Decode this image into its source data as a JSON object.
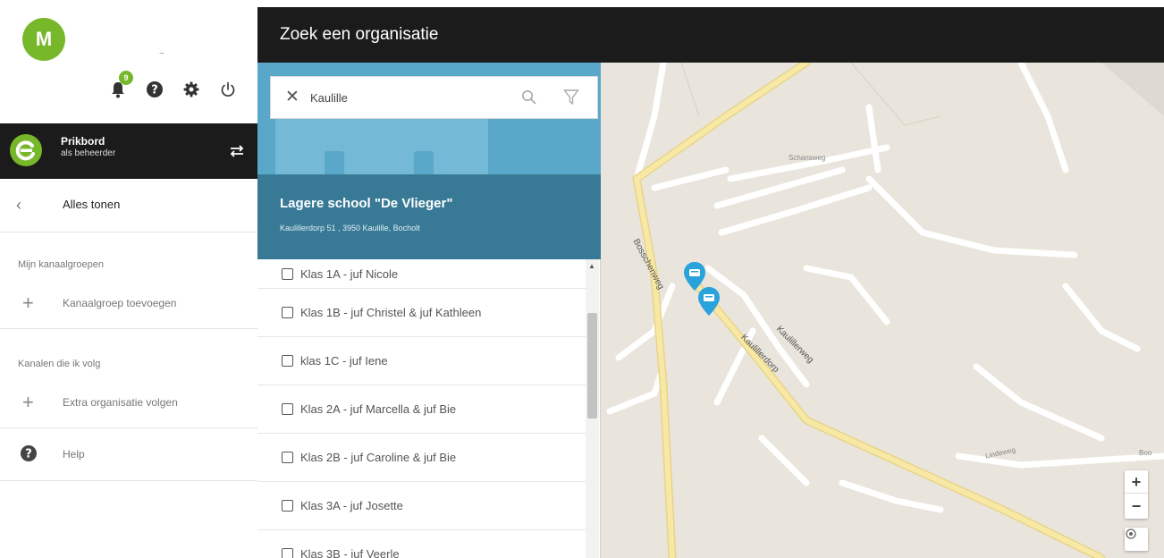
{
  "user": {
    "avatar_initial": "M",
    "subtitle": "~"
  },
  "notifications": {
    "count": "9"
  },
  "channel": {
    "name": "Prikbord",
    "role": "als beheerder"
  },
  "sidebar": {
    "show_all": "Alles tonen",
    "section_groups": "Mijn kanaalgroepen",
    "add_group": "Kanaalgroep toevoegen",
    "section_follow": "Kanalen die ik volg",
    "follow_org": "Extra organisatie volgen",
    "help": "Help"
  },
  "header": {
    "title": "Zoek een organisatie"
  },
  "search": {
    "value": "Kaulille"
  },
  "organization": {
    "name": "Lagere school \"De Vlieger\"",
    "address": "Kaulillerdorp 51 , 3950 Kaulille, Bocholt"
  },
  "classes": [
    "Klas 1A - juf Nicole",
    "Klas 1B - juf Christel & juf Kathleen",
    "klas 1C - juf Iene",
    "Klas 2A - juf Marcella & juf Bie",
    "Klas 2B - juf Caroline & juf Bie",
    "Klas 3A - juf Josette",
    "Klas 3B - juf Veerle"
  ],
  "map": {
    "streets": {
      "s1": "Schansweg",
      "s2": "Bosschenweg",
      "s3": "Kaulillerdorp",
      "s4": "Kaulillerweg",
      "s5": "Lindeweg",
      "s6": "Boo"
    },
    "zoom_in": "+",
    "zoom_out": "−"
  },
  "colors": {
    "accent": "#77b72a",
    "header_bg": "#1b1b1b",
    "hero_bg": "#5aa8c9",
    "selected_bg": "#387a96",
    "pin": "#2aa3dc",
    "map_bg": "#e9e5dc",
    "road_major": "#f7e8a6"
  },
  "icons": [
    "bell-icon",
    "help-icon",
    "gear-icon",
    "power-icon",
    "swap-icon",
    "chevron-left-icon",
    "plus-icon",
    "close-icon",
    "search-icon",
    "filter-icon",
    "locate-icon",
    "map-pin-icon"
  ]
}
